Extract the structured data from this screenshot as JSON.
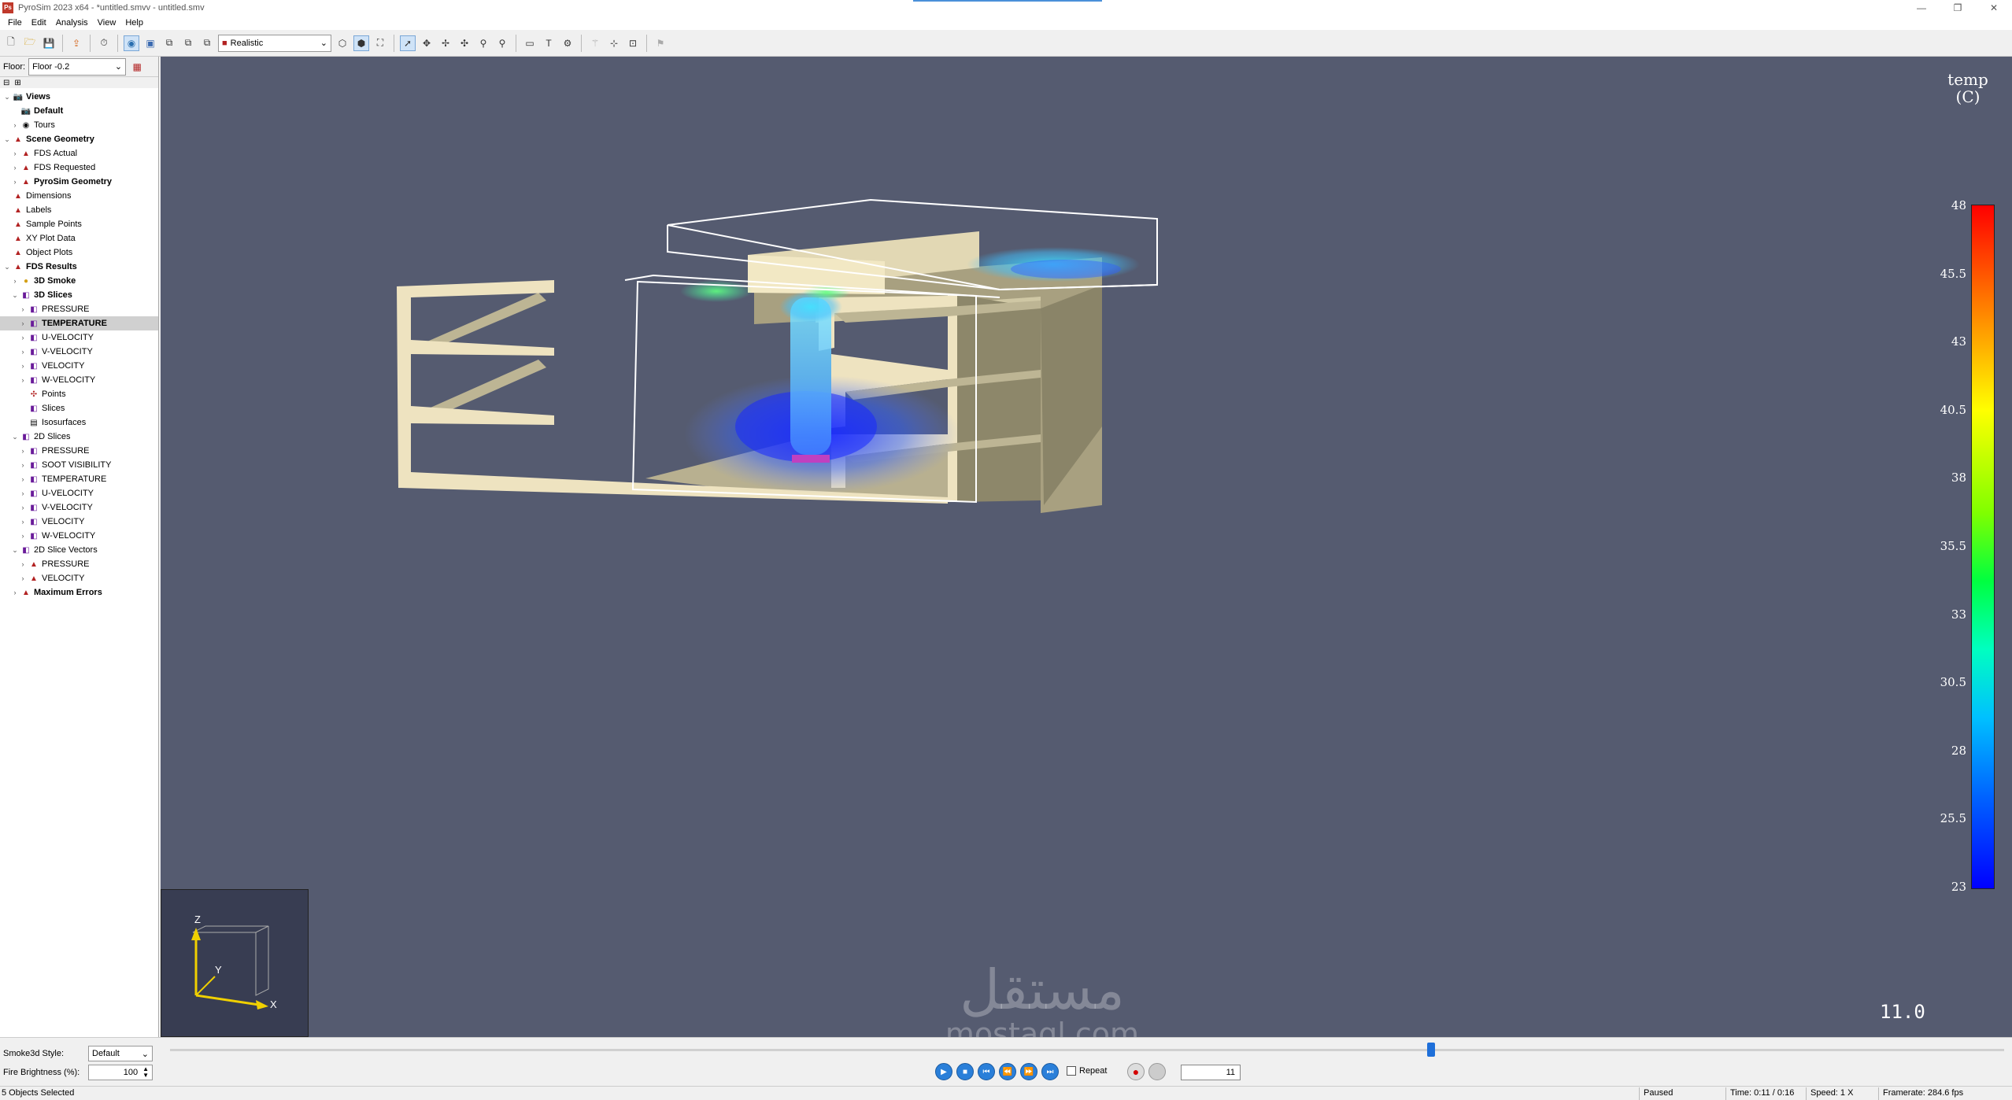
{
  "window": {
    "title": "PyroSim 2023 x64 - *untitled.smvv - untitled.smv",
    "icon": "pyrosim-app-icon"
  },
  "menu": [
    "File",
    "Edit",
    "Analysis",
    "View",
    "Help"
  ],
  "toolbar": {
    "render_mode": "Realistic"
  },
  "floor": {
    "label": "Floor:",
    "value": "Floor -0.2"
  },
  "tree": [
    {
      "label": "Views",
      "bold": true,
      "level": 0,
      "exp": "v",
      "icon": "camera-icon"
    },
    {
      "label": "Default",
      "bold": true,
      "level": 1,
      "exp": "",
      "icon": "camera-icon"
    },
    {
      "label": "Tours",
      "bold": false,
      "level": 1,
      "exp": ">",
      "icon": "tour-icon"
    },
    {
      "label": "Scene Geometry",
      "bold": true,
      "level": 0,
      "exp": "v",
      "icon": "geometry-icon"
    },
    {
      "label": "FDS Actual",
      "bold": false,
      "level": 1,
      "exp": ">",
      "icon": "geometry-icon"
    },
    {
      "label": "FDS Requested",
      "bold": false,
      "level": 1,
      "exp": ">",
      "icon": "geometry-icon"
    },
    {
      "label": "PyroSim Geometry",
      "bold": true,
      "level": 1,
      "exp": ">",
      "icon": "geometry-icon"
    },
    {
      "label": "Dimensions",
      "bold": false,
      "level": 0,
      "exp": "",
      "icon": "geometry-icon"
    },
    {
      "label": "Labels",
      "bold": false,
      "level": 0,
      "exp": "",
      "icon": "geometry-icon"
    },
    {
      "label": "Sample Points",
      "bold": false,
      "level": 0,
      "exp": "",
      "icon": "geometry-icon"
    },
    {
      "label": "XY Plot Data",
      "bold": false,
      "level": 0,
      "exp": "",
      "icon": "geometry-icon"
    },
    {
      "label": "Object Plots",
      "bold": false,
      "level": 0,
      "exp": "",
      "icon": "geometry-icon"
    },
    {
      "label": "FDS Results",
      "bold": true,
      "level": 0,
      "exp": "v",
      "icon": "geometry-icon"
    },
    {
      "label": "3D Smoke",
      "bold": true,
      "level": 1,
      "exp": ">",
      "icon": "smoke-icon"
    },
    {
      "label": "3D Slices",
      "bold": true,
      "level": 1,
      "exp": "v",
      "icon": "slice-icon"
    },
    {
      "label": "PRESSURE",
      "bold": false,
      "level": 2,
      "exp": ">",
      "icon": "slice-icon"
    },
    {
      "label": "TEMPERATURE",
      "bold": true,
      "level": 2,
      "exp": ">",
      "icon": "slice-icon",
      "selected": true
    },
    {
      "label": "U-VELOCITY",
      "bold": false,
      "level": 2,
      "exp": ">",
      "icon": "slice-icon"
    },
    {
      "label": "V-VELOCITY",
      "bold": false,
      "level": 2,
      "exp": ">",
      "icon": "slice-icon"
    },
    {
      "label": "VELOCITY",
      "bold": false,
      "level": 2,
      "exp": ">",
      "icon": "slice-icon"
    },
    {
      "label": "W-VELOCITY",
      "bold": false,
      "level": 2,
      "exp": ">",
      "icon": "slice-icon"
    },
    {
      "label": "Points",
      "bold": false,
      "level": 2,
      "exp": "",
      "icon": "points-icon"
    },
    {
      "label": "Slices",
      "bold": false,
      "level": 2,
      "exp": "",
      "icon": "slice-icon"
    },
    {
      "label": "Isosurfaces",
      "bold": false,
      "level": 2,
      "exp": "",
      "icon": "isosurface-icon"
    },
    {
      "label": "2D Slices",
      "bold": false,
      "level": 1,
      "exp": "v",
      "icon": "slice-icon"
    },
    {
      "label": "PRESSURE",
      "bold": false,
      "level": 2,
      "exp": ">",
      "icon": "slice-icon"
    },
    {
      "label": "SOOT VISIBILITY",
      "bold": false,
      "level": 2,
      "exp": ">",
      "icon": "slice-icon"
    },
    {
      "label": "TEMPERATURE",
      "bold": false,
      "level": 2,
      "exp": ">",
      "icon": "slice-icon"
    },
    {
      "label": "U-VELOCITY",
      "bold": false,
      "level": 2,
      "exp": ">",
      "icon": "slice-icon"
    },
    {
      "label": "V-VELOCITY",
      "bold": false,
      "level": 2,
      "exp": ">",
      "icon": "slice-icon"
    },
    {
      "label": "VELOCITY",
      "bold": false,
      "level": 2,
      "exp": ">",
      "icon": "slice-icon"
    },
    {
      "label": "W-VELOCITY",
      "bold": false,
      "level": 2,
      "exp": ">",
      "icon": "slice-icon"
    },
    {
      "label": "2D Slice Vectors",
      "bold": false,
      "level": 1,
      "exp": "v",
      "icon": "slice-icon"
    },
    {
      "label": "PRESSURE",
      "bold": false,
      "level": 2,
      "exp": ">",
      "icon": "geometry-icon"
    },
    {
      "label": "VELOCITY",
      "bold": false,
      "level": 2,
      "exp": ">",
      "icon": "geometry-icon"
    },
    {
      "label": "Maximum Errors",
      "bold": true,
      "level": 1,
      "exp": ">",
      "icon": "geometry-icon"
    }
  ],
  "legend": {
    "title_line1": "temp",
    "title_line2": "(C)",
    "ticks": [
      "48",
      "45.5",
      "43",
      "40.5",
      "38",
      "35.5",
      "33",
      "30.5",
      "28",
      "25.5",
      "23"
    ]
  },
  "time_readout": "11.0",
  "axes": {
    "z": "Z",
    "y": "Y",
    "x": "X"
  },
  "bottom": {
    "smoke_style_label": "Smoke3d Style:",
    "smoke_style_value": "Default",
    "fire_brightness_label": "Fire Brightness (%):",
    "fire_brightness_value": "100",
    "repeat_label": "Repeat",
    "frame_value": "11",
    "timeline_fraction": 0.6875
  },
  "status": {
    "selection": "5 Objects Selected",
    "state": "Paused",
    "time": "Time: 0:11 / 0:16",
    "speed": "Speed: 1 X",
    "framerate": "Framerate: 284.6 fps"
  },
  "watermark": {
    "arabic": "مستقل",
    "latin": "mostaql.com"
  }
}
